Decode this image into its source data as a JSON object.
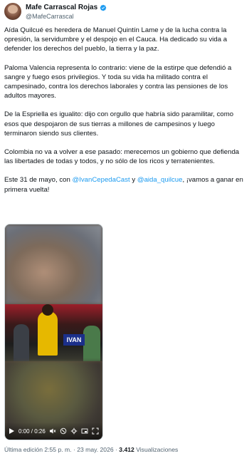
{
  "author": {
    "name": "Mafe Carrascal Rojas",
    "handle": "@MafeCarrascal",
    "verified_color": "#1d9bf0"
  },
  "tweet": {
    "paragraphs": [
      "Aída Quilcué es heredera de Manuel Quintín Lame y de la lucha contra la opresión, la servidumbre y el despojo en el Cauca. Ha dedicado su vida a defender los derechos del pueblo, la tierra y la paz.",
      "Paloma Valencia representa lo contrario: viene de la estirpe que defendió a sangre y fuego esos privilegios. Y toda su vida ha militado contra el campesinado, contra los derechos laborales y contra las pensiones de los adultos mayores.",
      "De la Espriella es igualito: dijo con orgullo que habría sido paramilitar, como esos que despojaron de sus tierras a millones de campesinos y luego terminaron siendo sus clientes.",
      "Colombia no va a volver a ese pasado: merecemos un gobierno que defienda las libertades de todas y todos, y no sólo de los ricos y terratenientes."
    ],
    "final": {
      "prefix": "Este 31 de mayo, con ",
      "mention1": "@IvanCepedaCast",
      "middle": " y ",
      "mention2": "@aida_quilcue",
      "suffix": ", ¡vamos a ganar en primera vuelta!"
    }
  },
  "video": {
    "time": "0:00 / 0:26",
    "sign_text": "IVAN",
    "progress": 0
  },
  "footer": {
    "edited": "Última edición 2:55 p. m. · 23 may. 2026 · ",
    "views_count": "3.412",
    "views_label": " Visualizaciones"
  },
  "icons": {
    "play": "play-icon",
    "mute": "volume-off-icon",
    "settings": "settings-icon",
    "fullscreen": "fullscreen-icon"
  }
}
